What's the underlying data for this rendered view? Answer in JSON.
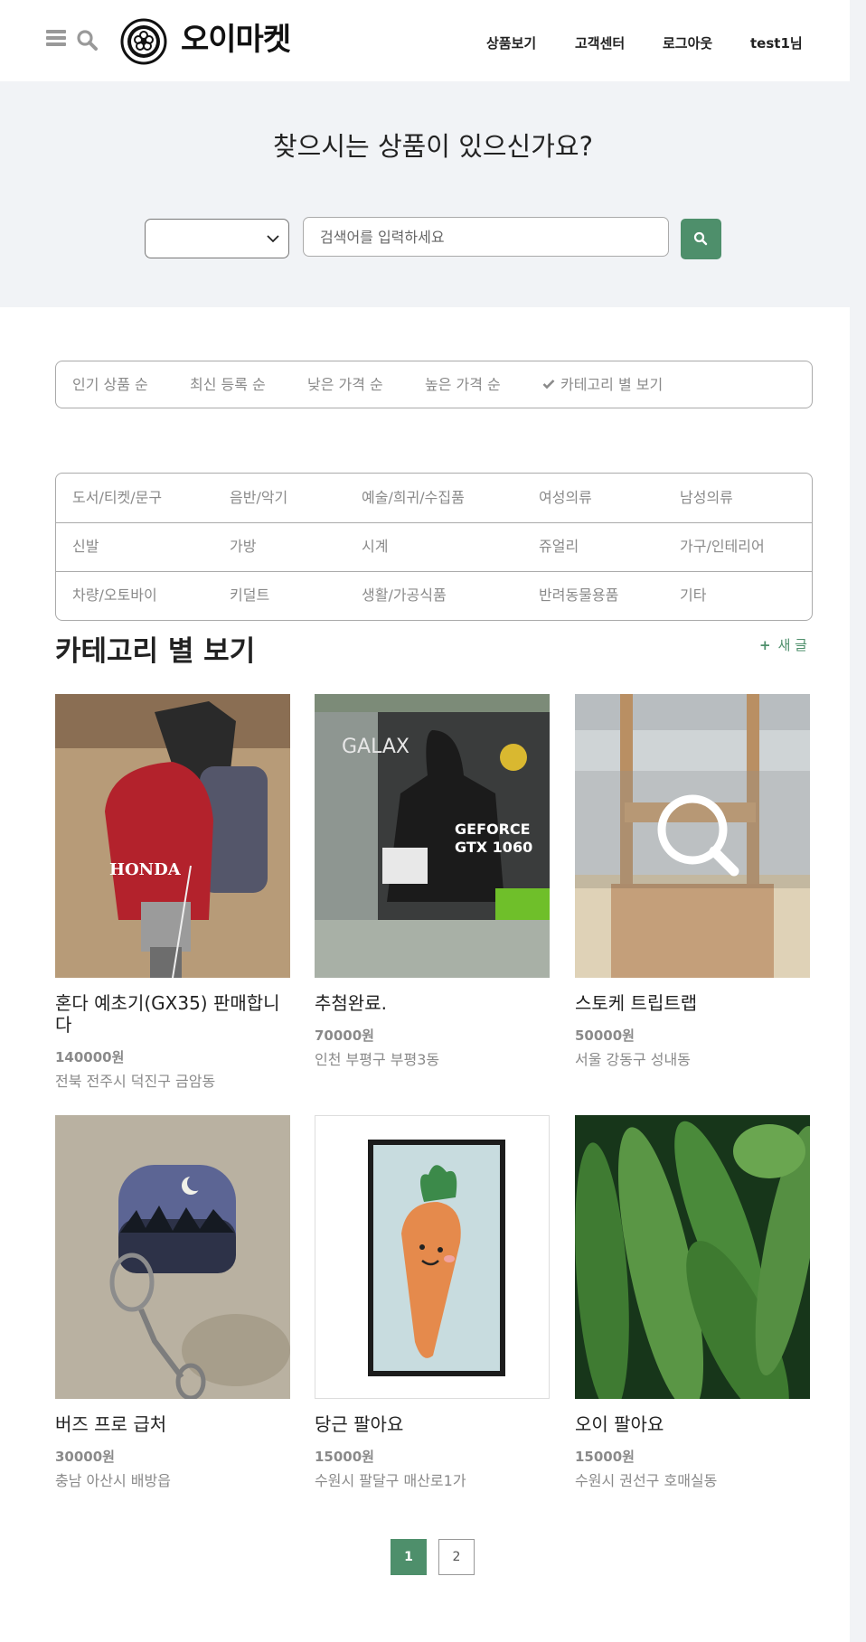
{
  "header": {
    "logo_text": "오이마켓",
    "nav": [
      "상품보기",
      "고객센터",
      "로그아웃",
      "test1님"
    ]
  },
  "hero": {
    "title": "찾으시는 상품이 있으신가요?",
    "select_value": "",
    "search_placeholder": "검색어를 입력하세요"
  },
  "sort": {
    "items": [
      "인기 상품 순",
      "최신 등록 순",
      "낮은 가격 순",
      "높은 가격 순",
      "카테고리 별 보기"
    ],
    "active_index": 4
  },
  "categories": [
    [
      "도서/티켓/문구",
      "음반/악기",
      "예술/희귀/수집품",
      "여성의류",
      "남성의류"
    ],
    [
      "신발",
      "가방",
      "시계",
      "쥬얼리",
      "가구/인테리어"
    ],
    [
      "차량/오토바이",
      "키덜트",
      "생활/가공식품",
      "반려동물용품",
      "기타"
    ]
  ],
  "section": {
    "title": "카테고리 별 보기",
    "new_post_label": "새 글"
  },
  "products": [
    {
      "title": "혼다 예초기(GX35) 판매합니다",
      "price": "140000원",
      "location": "전북 전주시 덕진구 금암동"
    },
    {
      "title": "추첨완료.",
      "price": "70000원",
      "location": "인천 부평구 부평3동"
    },
    {
      "title": "스토케 트립트랩",
      "price": "50000원",
      "location": "서울 강동구 성내동"
    },
    {
      "title": "버즈 프로 급처",
      "price": "30000원",
      "location": "충남 아산시 배방읍"
    },
    {
      "title": "당근 팔아요",
      "price": "15000원",
      "location": "수원시 팔달구 매산로1가"
    },
    {
      "title": "오이 팔아요",
      "price": "15000원",
      "location": "수원시 권선구 호매실동"
    }
  ],
  "pagination": {
    "pages": [
      "1",
      "2"
    ],
    "current": "1"
  },
  "colors": {
    "accent": "#4e8f6b",
    "hero_bg": "#f1f3f6",
    "muted_text": "#8a8a8a"
  },
  "icons": [
    "hamburger-icon",
    "search-icon",
    "logo-icon",
    "chevron-down-icon",
    "check-icon",
    "plus-icon"
  ]
}
